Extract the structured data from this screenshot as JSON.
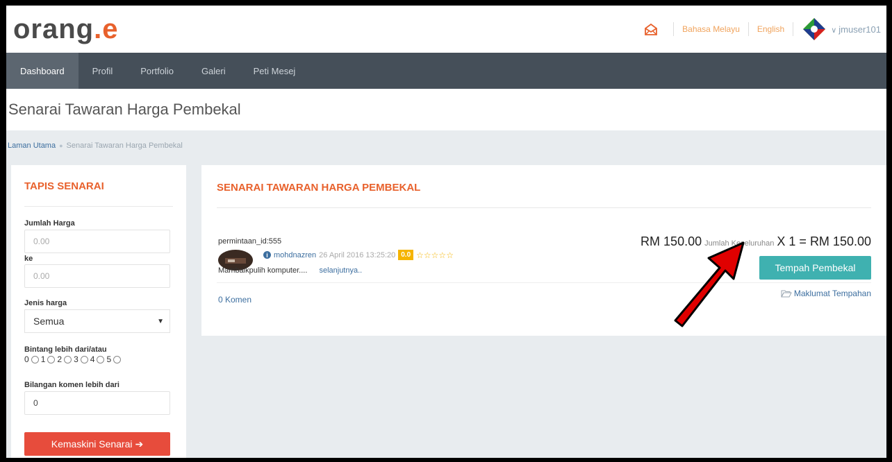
{
  "header": {
    "logo_main": "orang",
    "logo_accent": ".e",
    "lang_malay": "Bahasa Melayu",
    "lang_english": "English",
    "username": "jmuser101"
  },
  "nav": {
    "items": [
      "Dashboard",
      "Profil",
      "Portfolio",
      "Galeri",
      "Peti Mesej"
    ]
  },
  "page": {
    "title": "Senarai Tawaran Harga Pembekal",
    "breadcrumb_home": "Laman Utama",
    "breadcrumb_current": "Senarai Tawaran Harga Pembekal"
  },
  "filter": {
    "title": "TAPIS SENARAI",
    "price_label": "Jumlah Harga",
    "price_from_placeholder": "0.00",
    "to_label": "ke",
    "price_to_placeholder": "0.00",
    "price_type_label": "Jenis harga",
    "price_type_value": "Semua",
    "stars_label": "Bintang lebih dari/atau",
    "star_options": [
      "0",
      "1",
      "2",
      "3",
      "4",
      "5"
    ],
    "comments_label": "Bilangan komen lebih dari",
    "comments_value": "0",
    "update_button": "Kemaskini Senarai"
  },
  "listing_panel": {
    "title": "SENARAI TAWARAN HARGA PEMBEKAL",
    "items": [
      {
        "request_id": "permintaan_id:555",
        "username": "mohdnazren",
        "date": "26 April 2016 13:25:20",
        "rating": "0.0",
        "stars": "☆☆☆☆☆",
        "description": "Mambaikpulih komputer....",
        "more_link": "selanjutnya..",
        "comments": "0 Komen",
        "price": "RM 150.00",
        "total_label": "Jumlah Keseluruhan",
        "quantity_total": "X 1 = RM 150.00",
        "book_button": "Tempah Pembekal",
        "booking_info_link": "Maklumat Tempahan"
      }
    ]
  },
  "colors": {
    "accent": "#e8612c",
    "navbar": "#454f59",
    "book_button": "#3fb1b0",
    "update_button": "#e74c3c",
    "link": "#3c6e9f",
    "annotation_arrow": "#e00000"
  }
}
